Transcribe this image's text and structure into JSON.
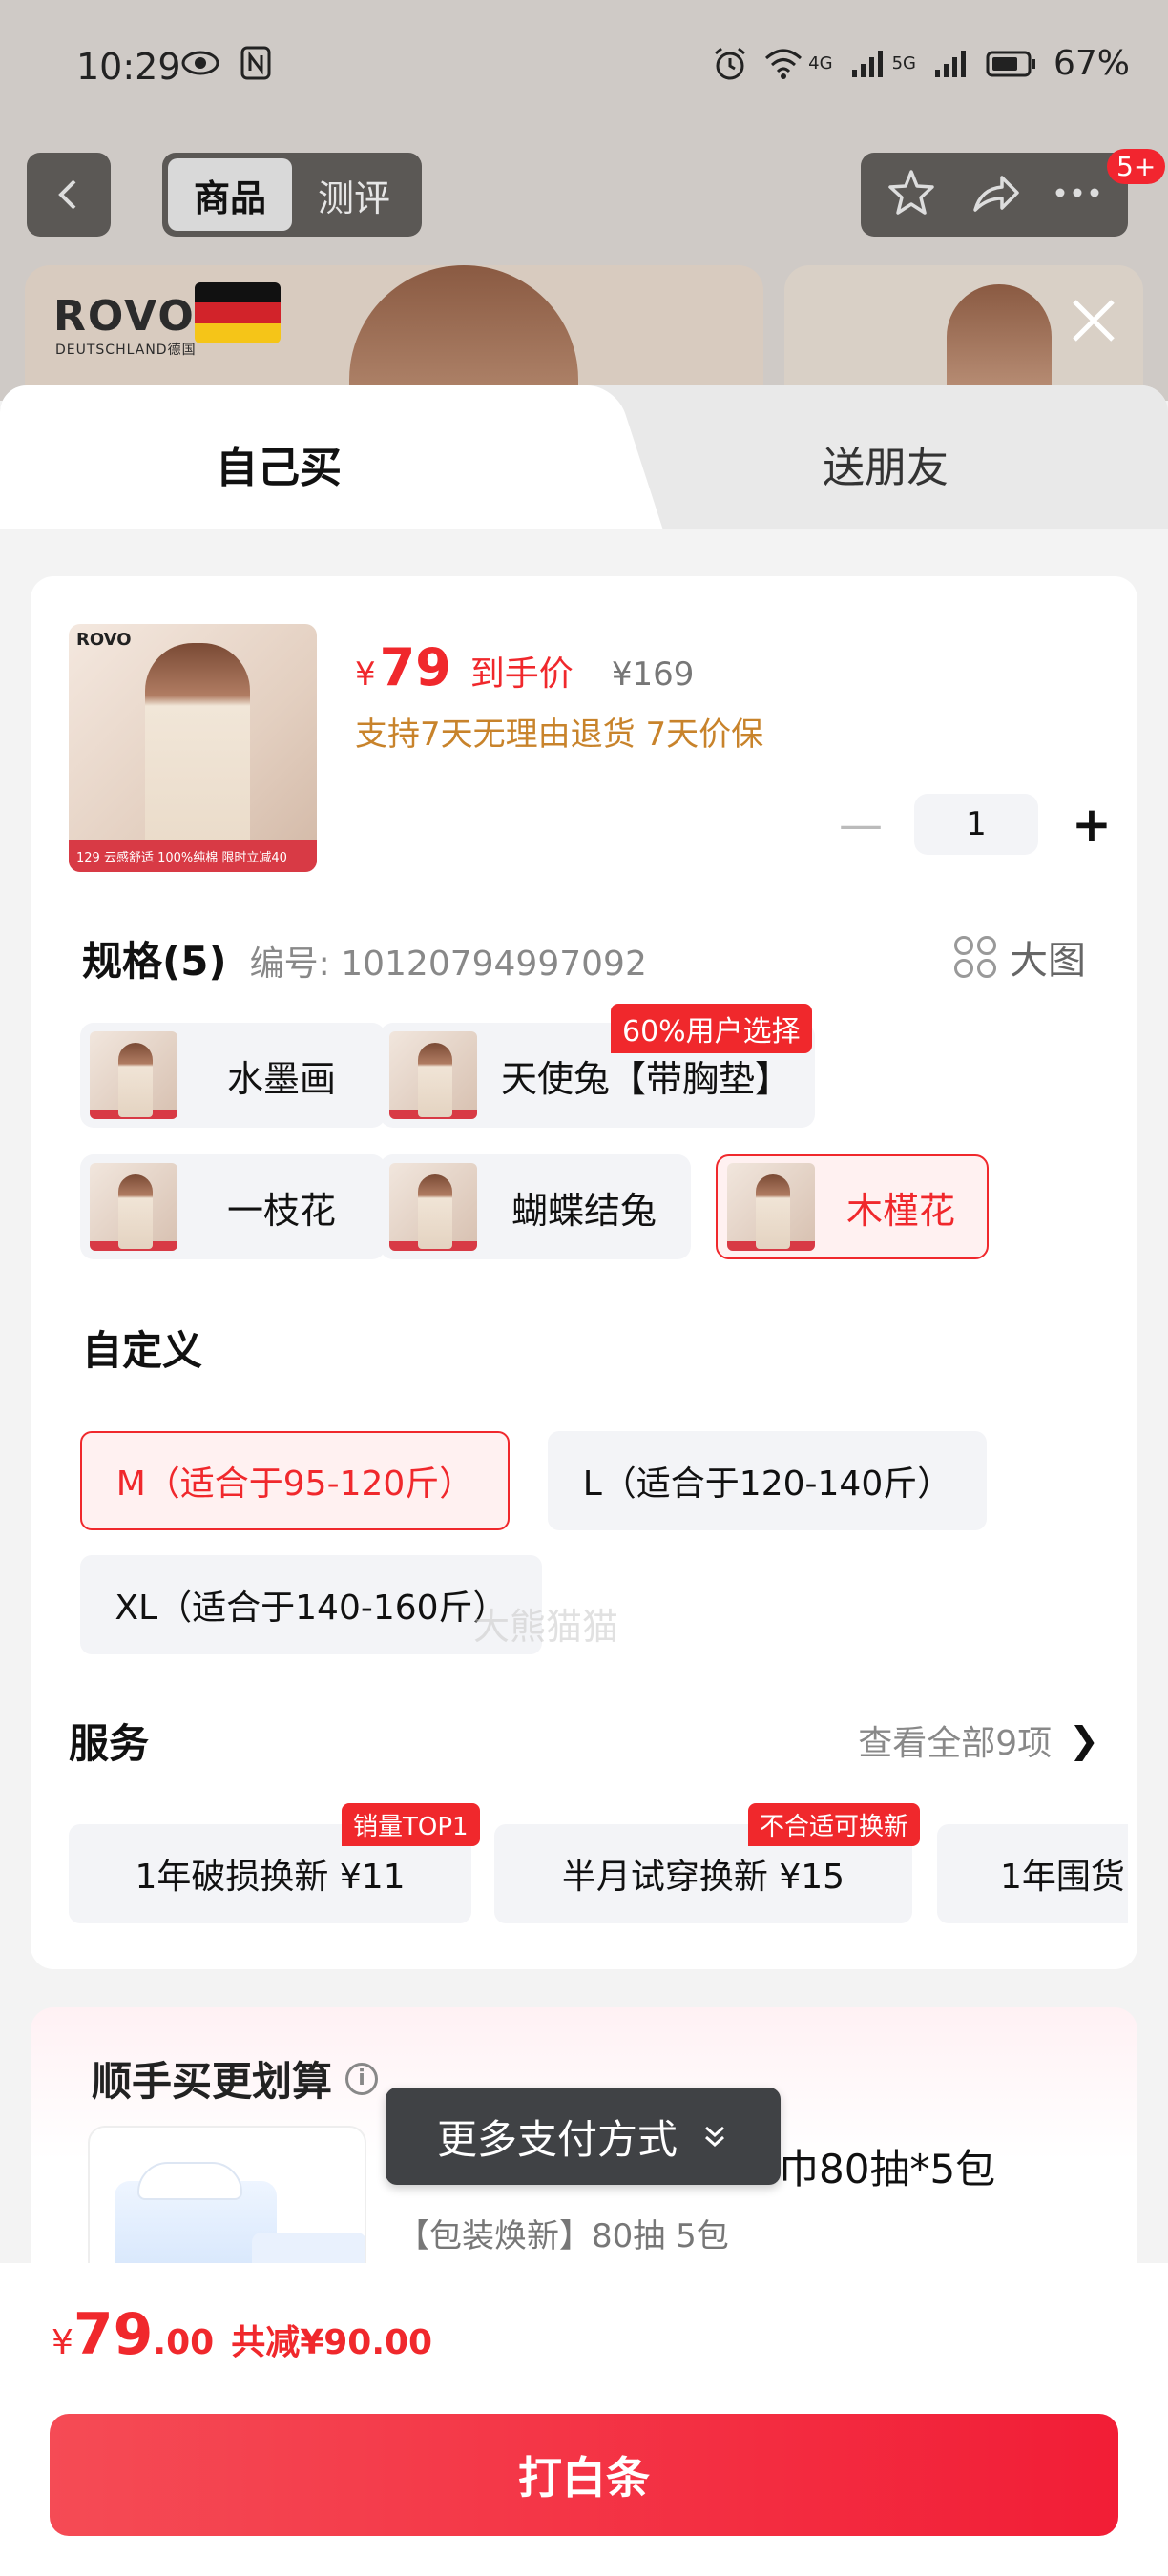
{
  "status_bar": {
    "time": "10:29",
    "net_4g": "4G",
    "net_5g": "5G",
    "battery": "67%"
  },
  "nav": {
    "tabs": [
      "商品",
      "测评"
    ],
    "badge": "5+"
  },
  "background_card": {
    "brand": "ROVO",
    "brand_sub": "DEUTSCHLAND德国"
  },
  "sheet_tabs": {
    "self": "自己买",
    "gift": "送朋友"
  },
  "product": {
    "thumb_logo": "ROVO",
    "thumb_strip": "129 云感舒适 100%纯棉 限时立减40",
    "currency": "¥",
    "price": "79",
    "price_label": "到手价",
    "orig_price": "¥169",
    "promo": "支持7天无理由退货 7天价保",
    "quantity": "1"
  },
  "spec": {
    "title": "规格(5)",
    "code": "编号: 10120794997092",
    "big_pic": "大图",
    "options": [
      {
        "label": "水墨画"
      },
      {
        "label": "天使兔【带胸垫】",
        "badge": "60%用户选择"
      },
      {
        "label": "一枝花"
      },
      {
        "label": "蝴蝶结兔"
      },
      {
        "label": "木槿花"
      }
    ]
  },
  "custom": {
    "title": "自定义",
    "sizes": [
      "M（适合于95-120斤）",
      "L（适合于120-140斤）",
      "XL（适合于140-160斤）"
    ]
  },
  "service": {
    "title": "服务",
    "view_all": "查看全部9项",
    "items": [
      {
        "label": "1年破损换新  ¥11",
        "badge": "销量TOP1"
      },
      {
        "label": "半月试穿换新  ¥15",
        "badge": "不合适可换新"
      },
      {
        "label": "1年围货"
      }
    ]
  },
  "addon": {
    "title": "顺手买更划算",
    "name": "巾80抽*5包",
    "desc": "【包装焕新】80抽 5包"
  },
  "more_pay": "更多支付方式",
  "watermark": "大熊猫猫",
  "total": {
    "currency": "¥",
    "int": "79",
    "dec": ".00",
    "save": "共减¥90.00"
  },
  "pay_button": "打白条",
  "colors": {
    "accent": "#f0282c",
    "promo": "#c8832b"
  }
}
